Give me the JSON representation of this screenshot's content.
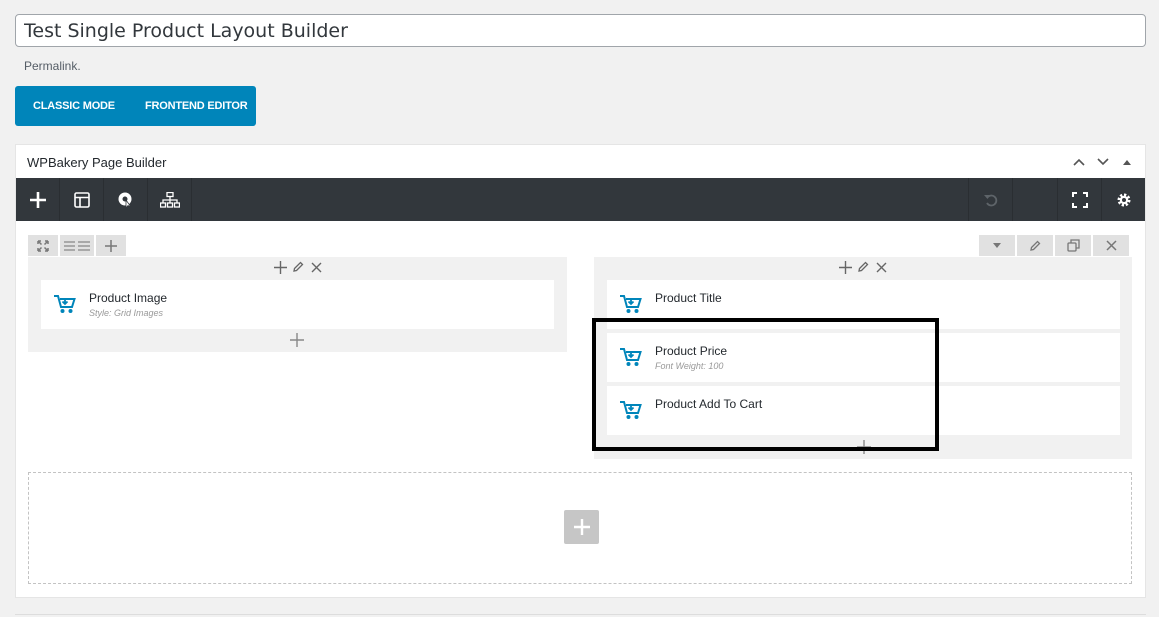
{
  "post": {
    "title": "Test Single Product Layout Builder",
    "permalink_label": "Permalink."
  },
  "modes": {
    "classic": "CLASSIC MODE",
    "frontend": "FRONTEND EDITOR"
  },
  "builder": {
    "title": "WPBakery Page Builder"
  },
  "columns": {
    "left": {
      "elements": [
        {
          "name": "Product Image",
          "sub": "Style: Grid Images"
        }
      ]
    },
    "right": {
      "elements": [
        {
          "name": "Product Title",
          "sub": ""
        },
        {
          "name": "Product Price",
          "sub": "Font Weight: 100"
        },
        {
          "name": "Product Add To Cart",
          "sub": ""
        }
      ]
    }
  },
  "colors": {
    "accent": "#0085ba",
    "toolbar": "#32373c",
    "element_icon": "#0085ba",
    "highlight": "#000000"
  },
  "icons": {
    "toolbar_left": [
      "plus-icon",
      "layout-icon",
      "template-icon",
      "sitemap-icon"
    ],
    "toolbar_right": [
      "undo-icon",
      "fullscreen-icon",
      "gear-icon"
    ],
    "element": "cart-icon"
  }
}
